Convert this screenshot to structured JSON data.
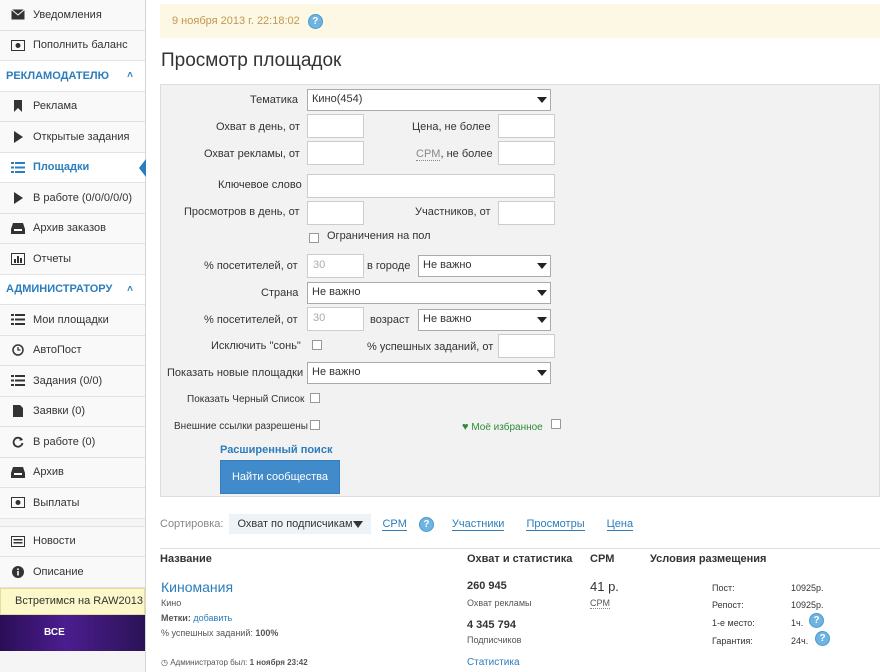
{
  "sidebar": {
    "top_items": [
      {
        "label": "Уведомления",
        "icon": "envelope-icon"
      },
      {
        "label": "Пополнить баланс",
        "icon": "money-icon"
      }
    ],
    "section_advertiser": "РЕКЛАМОДАТЕЛЮ",
    "advertiser_items": [
      {
        "label": "Реклама",
        "icon": "bookmark-icon"
      },
      {
        "label": "Открытые задания",
        "icon": "play-icon"
      },
      {
        "label": "Площадки",
        "icon": "list-icon",
        "active": true
      },
      {
        "label": "В работе (0/0/0/0/0)",
        "icon": "play-icon"
      },
      {
        "label": "Архив заказов",
        "icon": "inbox-icon"
      },
      {
        "label": "Отчеты",
        "icon": "bar-chart-icon"
      }
    ],
    "section_admin": "АДМИНИСТРАТОРУ",
    "admin_items": [
      {
        "label": "Мои площадки",
        "icon": "list-icon"
      },
      {
        "label": "АвтоПост",
        "icon": "clock-icon"
      },
      {
        "label": "Задания (0/0)",
        "icon": "list-icon"
      },
      {
        "label": "Заявки (0)",
        "icon": "file-icon"
      },
      {
        "label": "В работе (0)",
        "icon": "refresh-icon"
      },
      {
        "label": "Архив",
        "icon": "inbox-icon"
      },
      {
        "label": "Выплаты",
        "icon": "money-icon"
      }
    ],
    "bottom_items": [
      {
        "label": "Новости",
        "icon": "newspaper-icon"
      },
      {
        "label": "Описание",
        "icon": "info-icon"
      }
    ],
    "promo_text": "Встретимся на RAW2013",
    "promo_banner": "ВСЕ"
  },
  "header": {
    "datetime": "9 ноября 2013 г. 22:18:02",
    "help": "?",
    "title": "Просмотр площадок"
  },
  "filters": {
    "topic_label": "Тематика",
    "topic_value": "Кино(454)",
    "reach_day_label": "Охват в день, от",
    "price_label": "Цена, не более",
    "ad_reach_label": "Охват рекламы, от",
    "cpm_abbr": "CPM",
    "cpm_suffix": ", не более",
    "keyword_label": "Ключевое слово",
    "views_day_label": "Просмотров в день, от",
    "members_label": "Участников, от",
    "gender_limit_label": "Ограничения на пол",
    "visitors_city_label": "% посетителей, от",
    "visitors_city_value": "30",
    "in_city_label": "в городе",
    "city_value": "Не важно",
    "country_label": "Страна",
    "country_value": "Не важно",
    "visitors_age_label": "% посетителей, от",
    "visitors_age_value": "30",
    "age_label": "возраст",
    "age_value": "Не важно",
    "exclude_sleep_label": "Исключить \"сонь\"",
    "success_tasks_label": "% успешных заданий, от",
    "show_new_label": "Показать новые площадки",
    "show_new_value": "Не важно",
    "show_blacklist_label": "Показать Черный Список",
    "external_links_label": "Внешние ссылки разрешены",
    "favorites_label": "Моё избранное",
    "advanced_search": "Расширенный поиск",
    "find_button": "Найти сообщества"
  },
  "sort": {
    "label": "Сортировка:",
    "selected": "Охват по подписчикам",
    "links": [
      "CPM",
      "Участники",
      "Просмотры",
      "Цена"
    ],
    "help": "?"
  },
  "table": {
    "headers": {
      "name": "Название",
      "reach": "Охват и статистика",
      "cpm": "CPM",
      "conditions": "Условия размещения"
    },
    "row": {
      "name": "Киномания",
      "category": "Кино",
      "tags_label": "Метки:",
      "tags_link": "добавить",
      "success_label": "% успешных заданий:",
      "success_value": "100%",
      "admin_seen_label": "Администратор был:",
      "admin_seen_value": "1 ноября 23:42",
      "ad_reach": "260 945",
      "ad_reach_label": "Охват рекламы",
      "subscribers": "4 345 794",
      "subscribers_label": "Подписчиков",
      "stats_link": "Статистика",
      "cpm_value": "41 р.",
      "cpm_label": "CPM",
      "conditions": [
        {
          "label": "Пост:",
          "value": "10925р."
        },
        {
          "label": "Репост:",
          "value": "10925р."
        },
        {
          "label": "1-е место:",
          "value": "1ч."
        },
        {
          "label": "Гарантия:",
          "value": "24ч."
        }
      ]
    }
  },
  "colors": {
    "accent": "#2b7dbc",
    "button": "#428bca",
    "date_bg": "#fcf8e3",
    "panel_bg": "#f2f2f2"
  }
}
